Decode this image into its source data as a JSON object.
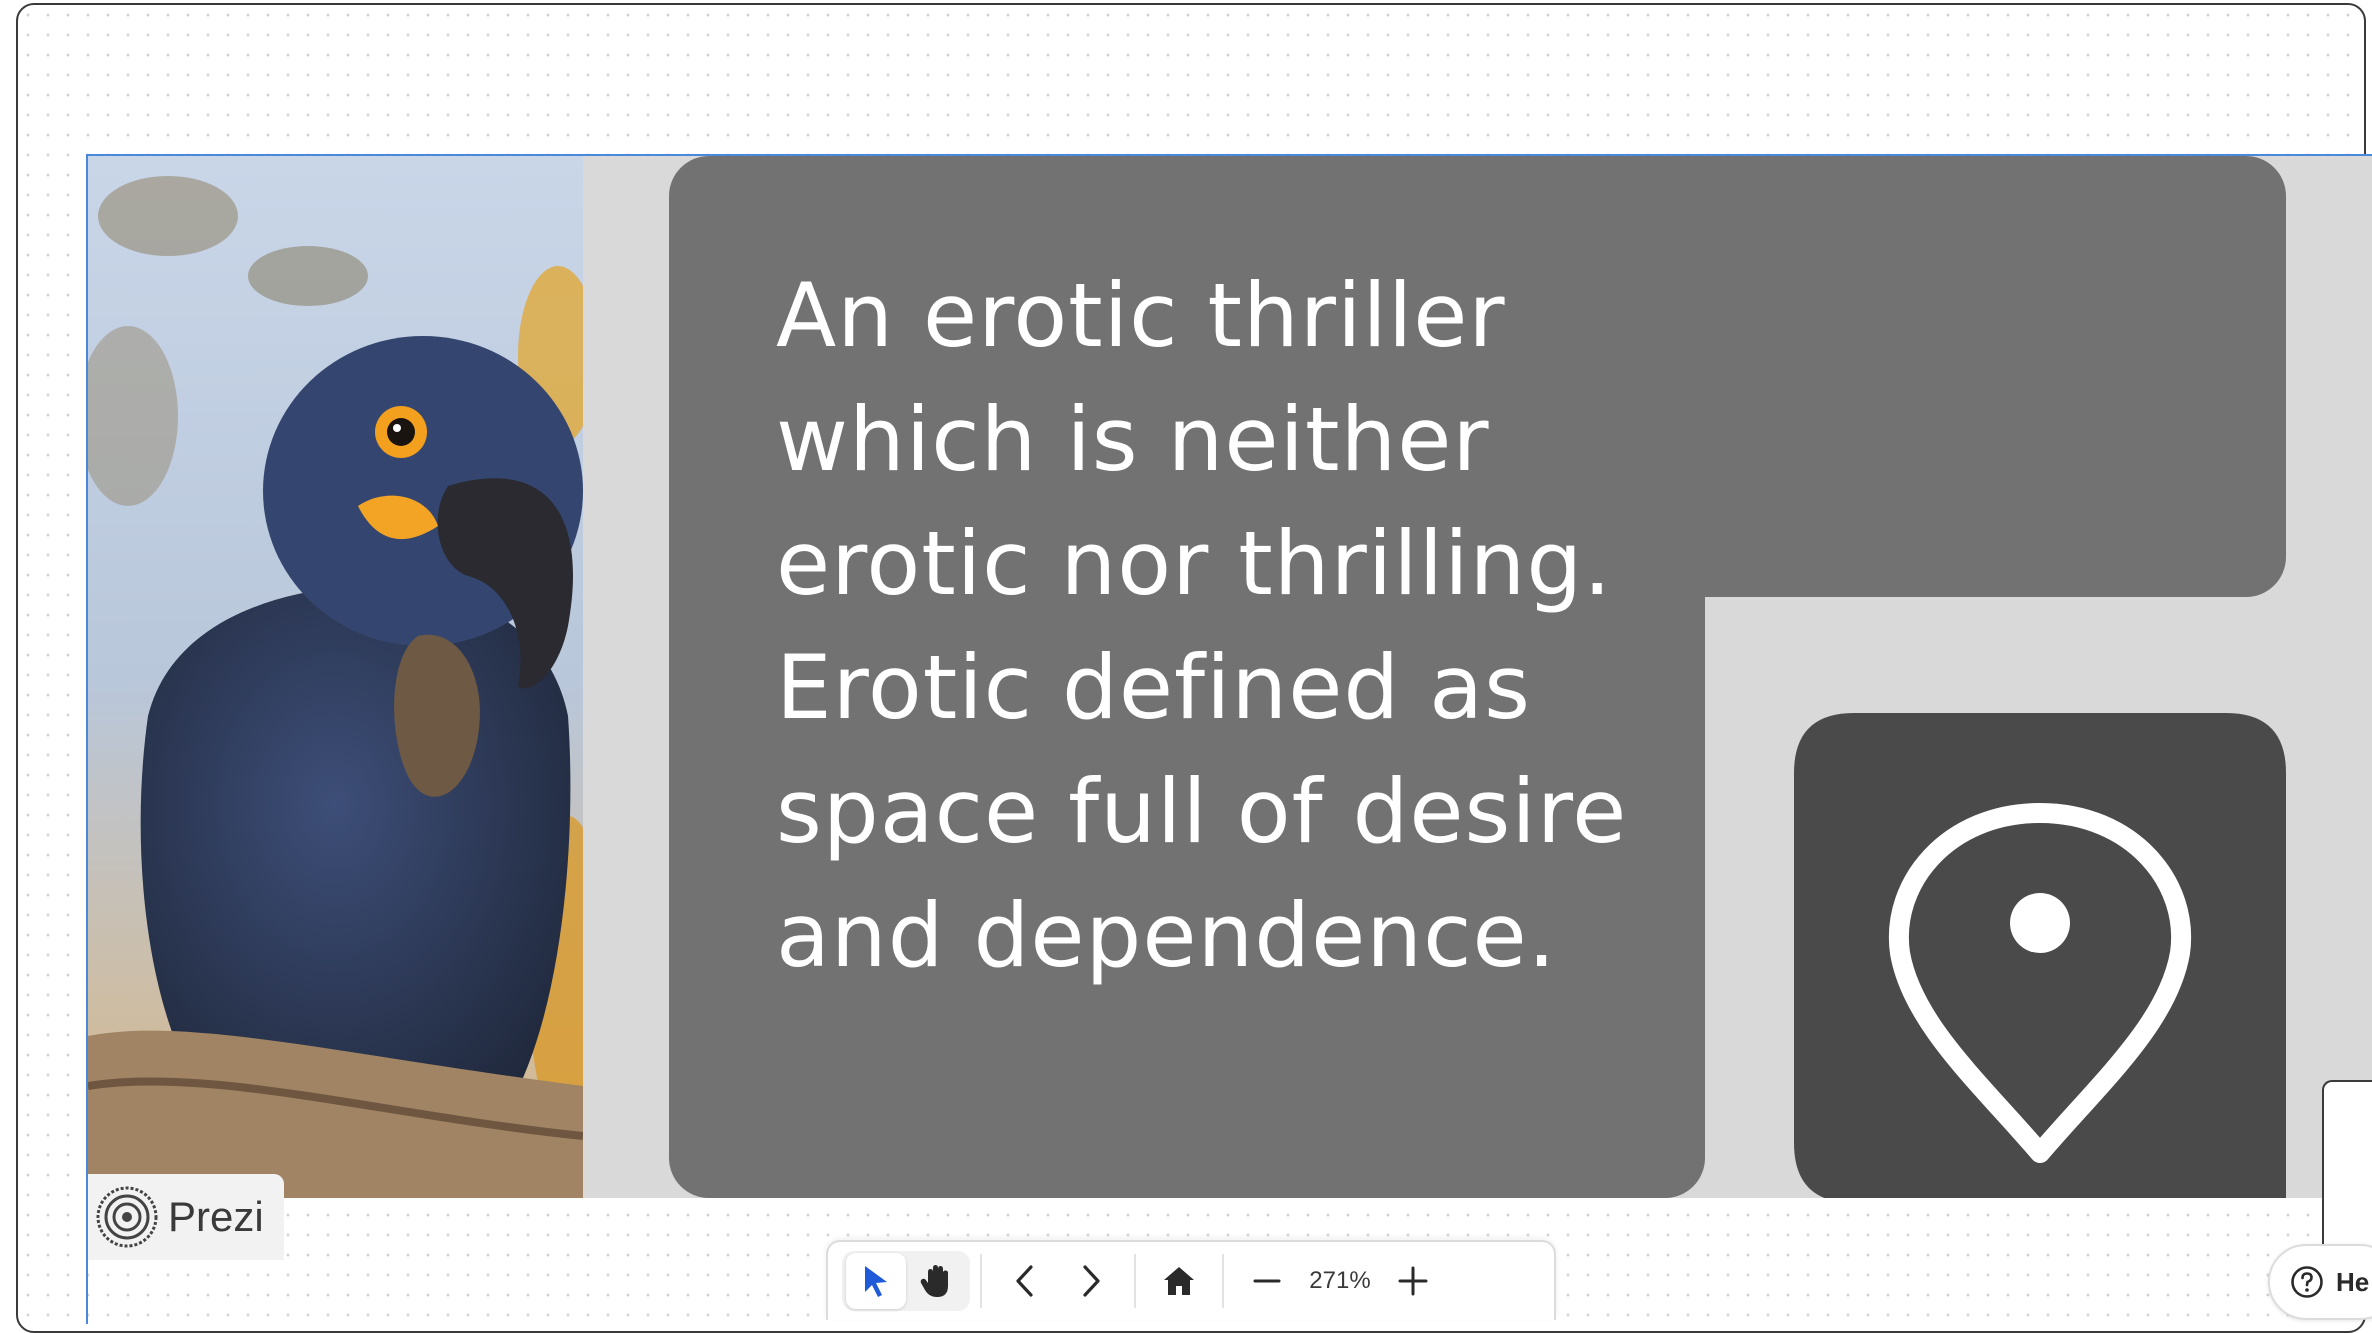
{
  "slide": {
    "quote_lines": [
      "An erotic thriller",
      "which is neither",
      "erotic nor thrilling.",
      "Erotic defined as",
      "space full of desire",
      "and dependence."
    ]
  },
  "branding": {
    "logo_text": "Prezi"
  },
  "toolbar": {
    "select_tool_icon": "cursor-arrow-icon",
    "hand_tool_icon": "hand-icon",
    "previous_icon": "chevron-left-icon",
    "next_icon": "chevron-right-icon",
    "home_icon": "home-icon",
    "zoom_out_icon": "minus-icon",
    "zoom_level": "271%",
    "zoom_in_icon": "plus-icon"
  },
  "help": {
    "label": "He",
    "icon": "question-icon"
  },
  "colors": {
    "slide_background": "#d9d9d9",
    "text_panel": "#727272",
    "pin_bubble": "#4a4a4a",
    "selection": "#4a88d8",
    "active_tool": "#1f5bd8"
  }
}
